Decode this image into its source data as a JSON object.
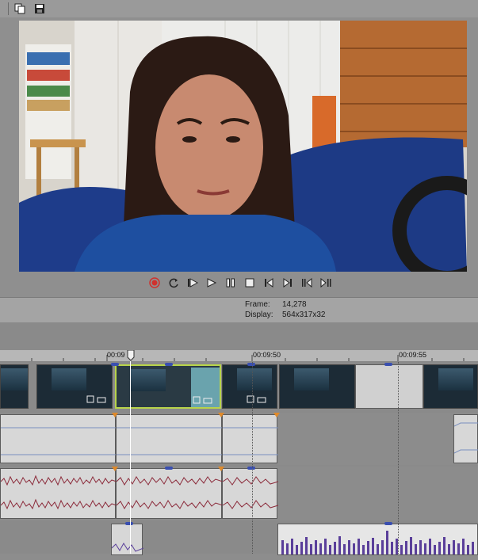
{
  "toolbar": {
    "buttons": [
      {
        "icon": "copy-snapshot-icon"
      },
      {
        "icon": "save-icon"
      }
    ]
  },
  "preview": {
    "transport": [
      {
        "icon": "record-icon"
      },
      {
        "icon": "loop-icon"
      },
      {
        "icon": "play-from-start-icon"
      },
      {
        "icon": "play-icon"
      },
      {
        "icon": "pause-icon"
      },
      {
        "icon": "stop-icon"
      },
      {
        "icon": "go-to-start-icon"
      },
      {
        "icon": "go-to-end-icon"
      },
      {
        "icon": "previous-frame-icon"
      },
      {
        "icon": "next-frame-icon"
      }
    ]
  },
  "info": {
    "frame_label": "Frame:",
    "frame_value": "14,278",
    "display_label": "Display:",
    "display_value": "564x317x32"
  },
  "ruler": {
    "labels": [
      "00:09",
      "00:09:50",
      "00:09:55"
    ]
  },
  "colors": {
    "selected_clip_outline": "#b8d44a",
    "audio_waveform": "#8b2a3a",
    "music_waveform": "#5a3f9a",
    "record_red": "#d0312d"
  }
}
